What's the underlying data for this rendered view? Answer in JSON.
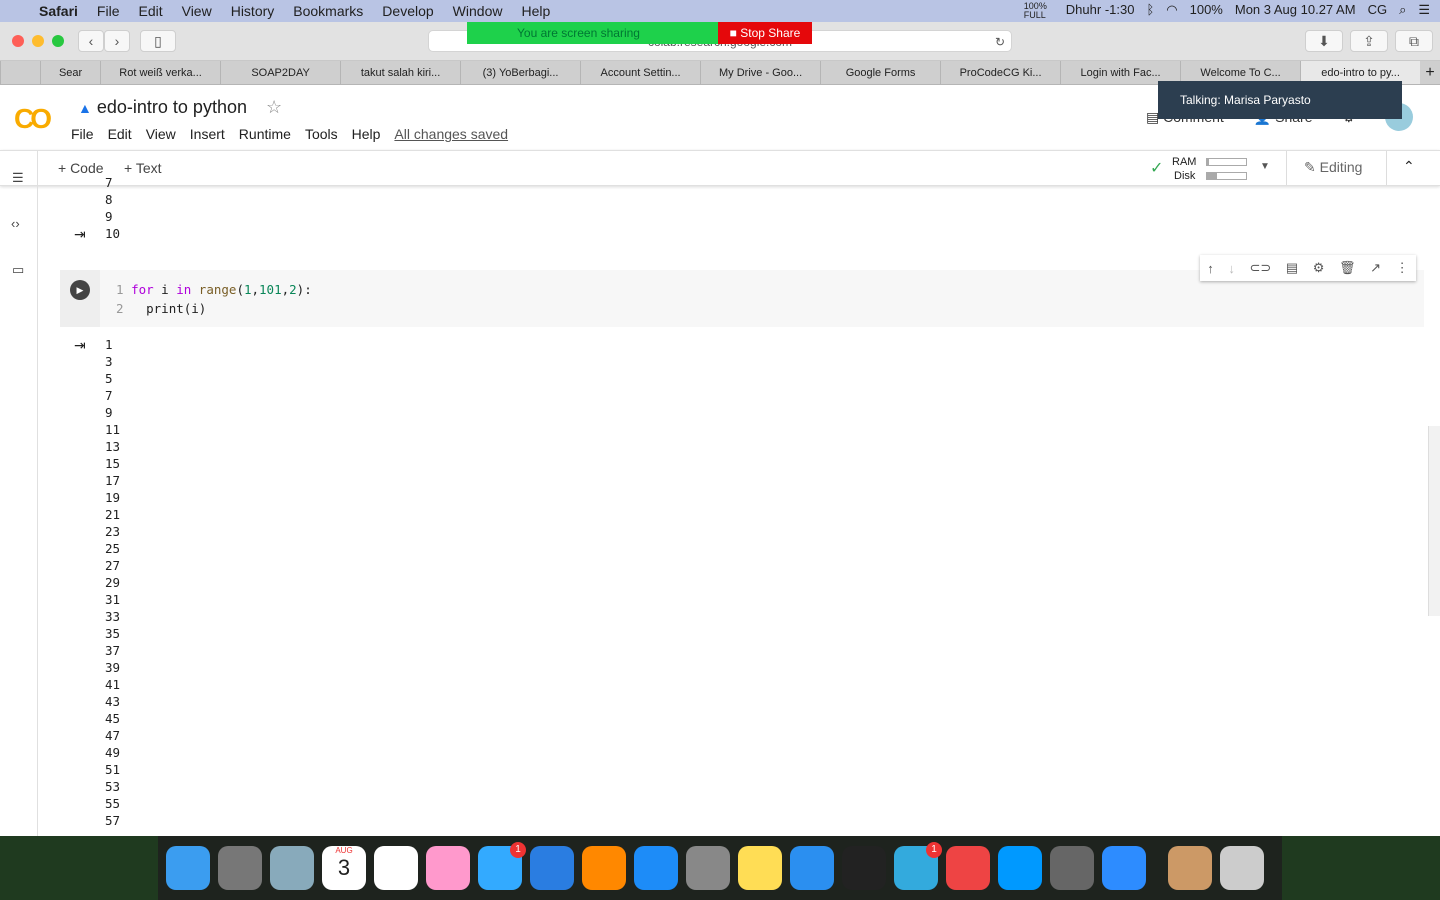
{
  "menubar": {
    "app": "Safari",
    "items": [
      "File",
      "Edit",
      "View",
      "History",
      "Bookmarks",
      "Develop",
      "Window",
      "Help"
    ],
    "battery_small": "100% FULL",
    "prayer": "Dhuhr -1:30",
    "battery": "100%",
    "datetime": "Mon 3 Aug  10.27 AM",
    "user": "CG"
  },
  "share": {
    "status": "You are screen sharing",
    "stop": "Stop Share"
  },
  "safari": {
    "url": "colab.research.google.com"
  },
  "tabs": [
    "Sear",
    "Rot weiß verka...",
    "SOAP2DAY",
    "takut salah kiri...",
    "(3) YoBerbagi...",
    "Account Settin...",
    "My Drive - Goo...",
    "Google Forms",
    "ProCodeCG Ki...",
    "Login with Fac...",
    "Welcome To C...",
    "edo-intro to py..."
  ],
  "colab": {
    "logo": "CO",
    "title": "edo-intro to python",
    "menu": [
      "File",
      "Edit",
      "View",
      "Insert",
      "Runtime",
      "Tools",
      "Help"
    ],
    "saved": "All changes saved",
    "comment": "Comment",
    "share": "Share",
    "toast": "Talking: Marisa Paryasto"
  },
  "toolbar": {
    "code": "+ Code",
    "text": "+ Text",
    "ram": "RAM",
    "disk": "Disk",
    "ram_usage": 0.05,
    "disk_usage": 0.25,
    "editing": "Editing"
  },
  "prev_output": [
    "7",
    "8",
    "9",
    "10"
  ],
  "cell": {
    "line1": "1",
    "line2": "2",
    "kw_for": "for",
    "var": " i ",
    "kw_in": "in",
    "fn": " range",
    "open": "(",
    "n1": "1",
    ",1": ",",
    "n2": "101",
    ",2": ",",
    "n3": "2",
    "close": "):",
    "line2code": "  print(i)"
  },
  "output": [
    "1",
    "3",
    "5",
    "7",
    "9",
    "11",
    "13",
    "15",
    "17",
    "19",
    "21",
    "23",
    "25",
    "27",
    "29",
    "31",
    "33",
    "35",
    "37",
    "39",
    "41",
    "43",
    "45",
    "47",
    "49",
    "51",
    "53",
    "55",
    "57"
  ],
  "dock": {
    "calendar_month": "AUG",
    "calendar_day": "3",
    "badge_messages": "1",
    "badge_app": "1"
  }
}
